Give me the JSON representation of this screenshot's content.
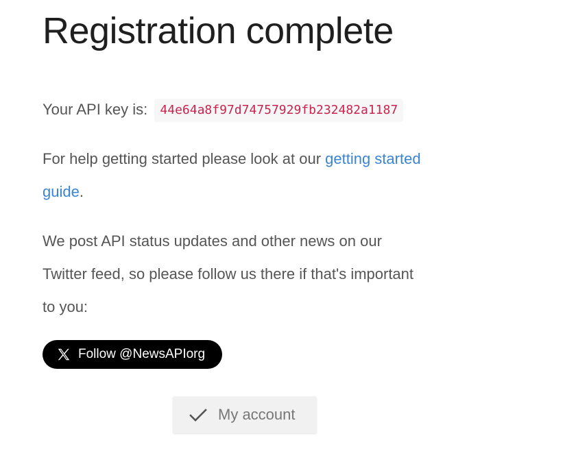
{
  "page": {
    "title": "Registration complete"
  },
  "api_key": {
    "label": "Your API key is:",
    "value": "44e64a8f97d74757929fb232482a1187"
  },
  "help": {
    "text_before": "For help getting started please look at our ",
    "link_text": "getting started guide",
    "text_after": "."
  },
  "twitter": {
    "text": "We post API status updates and other news on our Twitter feed, so please follow us there if that's important to you:",
    "follow_label": "Follow @NewsAPIorg"
  },
  "account": {
    "button_label": "My account"
  },
  "icons": {
    "follow": "x-logo-icon",
    "account": "checkmark-icon"
  },
  "colors": {
    "link": "#3b84d4",
    "api_key_text": "#c7254e",
    "follow_button_bg": "#000000",
    "account_button_bg": "#f1f1f1"
  }
}
